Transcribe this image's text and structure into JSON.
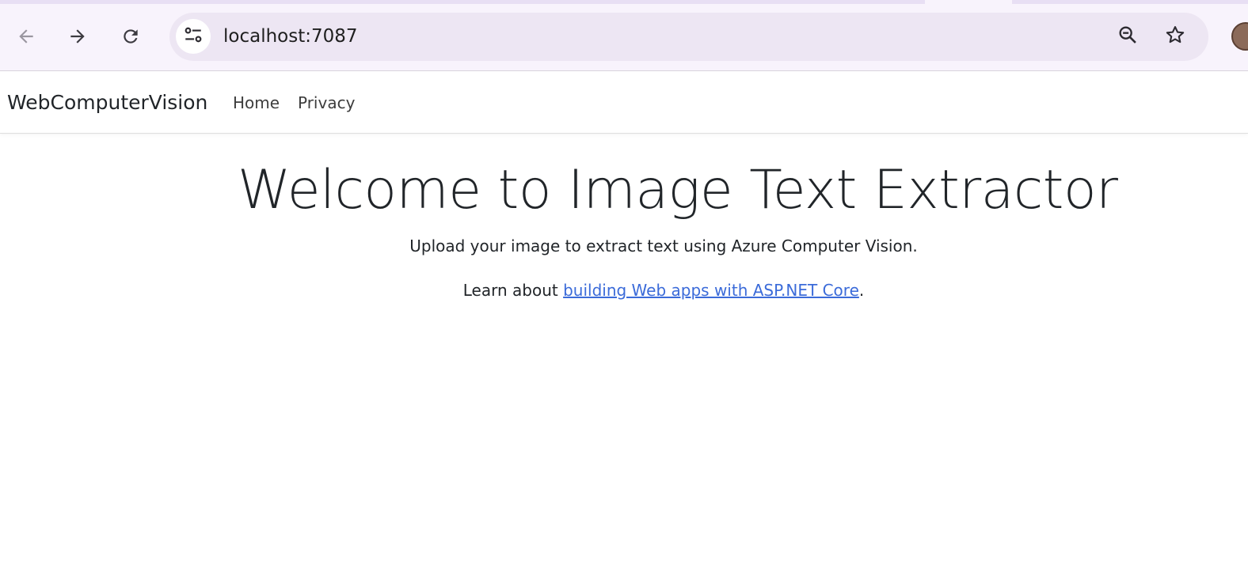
{
  "browser": {
    "url": "localhost:7087",
    "back_icon": "arrow-left-icon",
    "forward_icon": "arrow-right-icon",
    "reload_icon": "reload-icon",
    "site_info_icon": "tune-icon",
    "zoom_icon": "zoom-out-icon",
    "bookmark_icon": "star-icon",
    "colors": {
      "toolbar_bg": "#f8f3fc",
      "omnibox_bg": "#ede6f3"
    }
  },
  "navbar": {
    "brand": "WebComputerVision",
    "links": [
      {
        "label": "Home"
      },
      {
        "label": "Privacy"
      }
    ]
  },
  "main": {
    "title": "Welcome to Image Text Extractor",
    "lead": "Upload your image to extract text using Azure Computer Vision.",
    "learn_prefix": "Learn about ",
    "learn_link": "building Web apps with ASP.NET Core",
    "learn_suffix": ".",
    "link_color": "#3b6bd9"
  }
}
